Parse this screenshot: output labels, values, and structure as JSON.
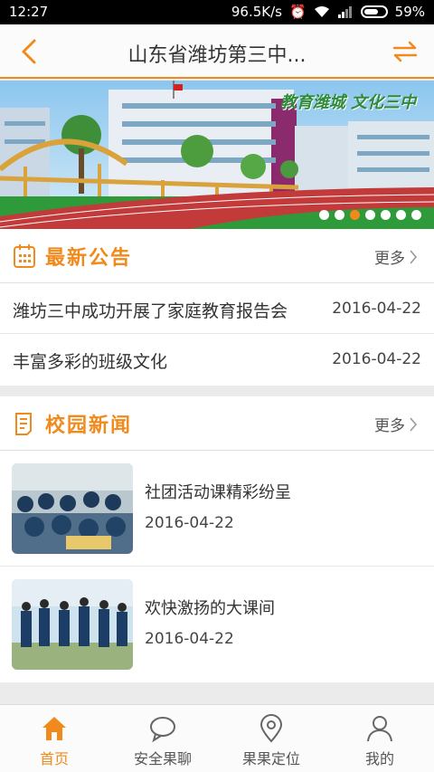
{
  "status_bar": {
    "time": "12:27",
    "speed": "96.5K/s",
    "battery": "59%"
  },
  "title_bar": {
    "title": "山东省潍坊第三中..."
  },
  "banner": {
    "slogan": "教育潍城 文化三中",
    "slide_count": 7,
    "active_slide": 3
  },
  "notices": {
    "title": "最新公告",
    "more_label": "更多",
    "items": [
      {
        "title": "潍坊三中成功开展了家庭教育报告会",
        "date": "2016-04-22"
      },
      {
        "title": "丰富多彩的班级文化",
        "date": "2016-04-22"
      }
    ]
  },
  "news": {
    "title": "校园新闻",
    "more_label": "更多",
    "items": [
      {
        "title": "社团活动课精彩纷呈",
        "date": "2016-04-22"
      },
      {
        "title": "欢快激扬的大课间",
        "date": "2016-04-22"
      }
    ]
  },
  "tabs": [
    {
      "label": "首页",
      "icon": "home-icon",
      "active": true
    },
    {
      "label": "安全果聊",
      "icon": "chat-icon",
      "active": false
    },
    {
      "label": "果果定位",
      "icon": "location-pin-icon",
      "active": false
    },
    {
      "label": "我的",
      "icon": "person-icon",
      "active": false
    }
  ],
  "colors": {
    "accent": "#f08a1c",
    "text": "#333333",
    "background": "#ebebeb"
  }
}
